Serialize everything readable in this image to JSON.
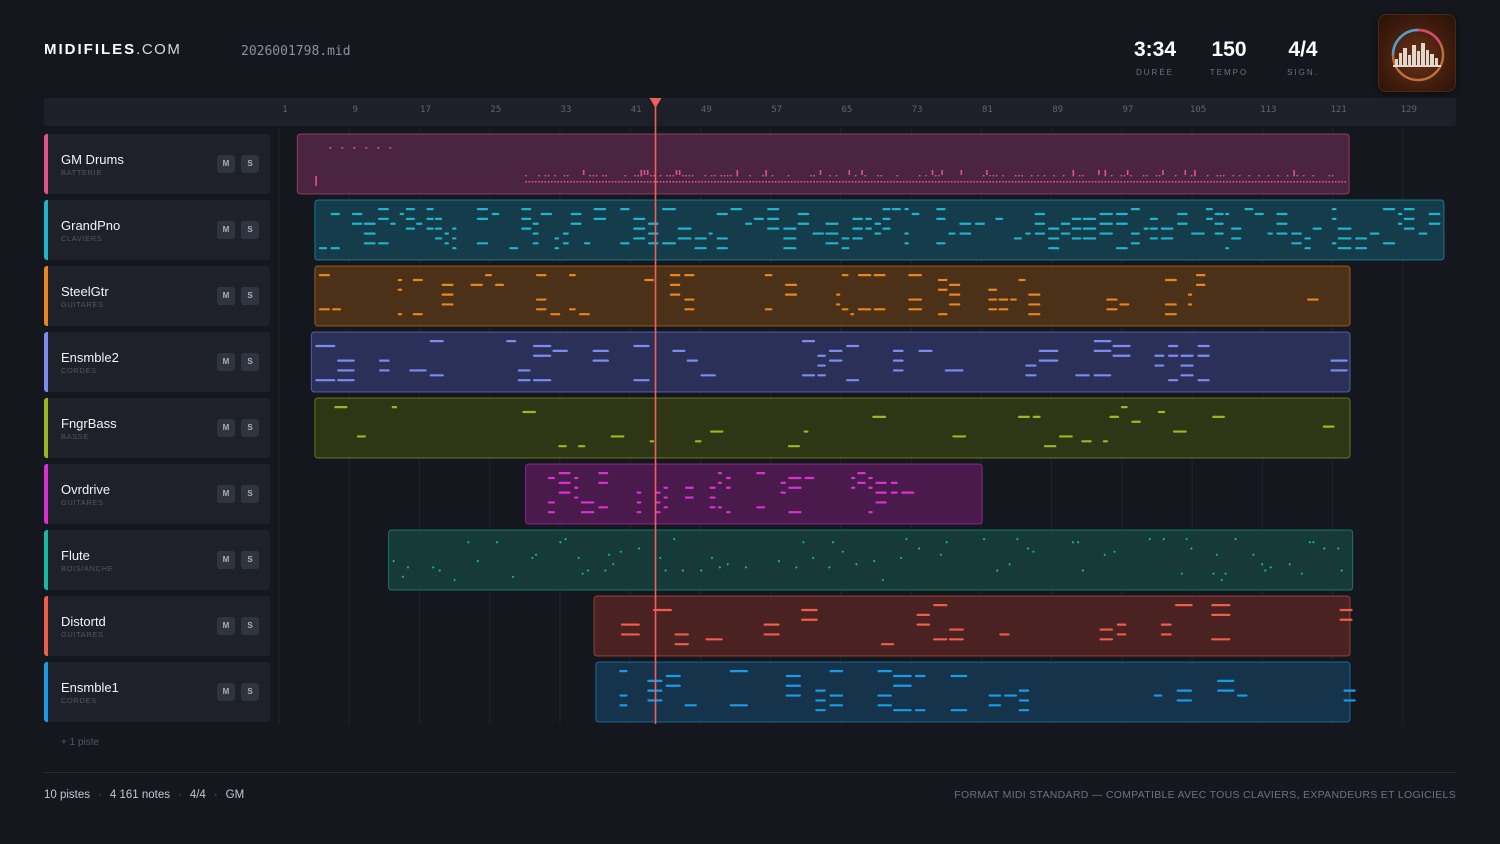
{
  "header": {
    "logo_bold": "MIDIFILES",
    "logo_light": ".COM",
    "filename": "2026001798.mid",
    "stats": [
      {
        "value": "3:34",
        "label": "DURÉE"
      },
      {
        "value": "150",
        "label": "TEMPO"
      },
      {
        "value": "4/4",
        "label": "SIGN."
      }
    ],
    "cover_icon": "album-cover-skyline-icon"
  },
  "ruler": {
    "bars": [
      "1",
      "9",
      "17",
      "25",
      "33",
      "41",
      "49",
      "57",
      "65",
      "73",
      "81",
      "89",
      "97",
      "105",
      "113",
      "121",
      "129"
    ],
    "playhead_bar": 43.2
  },
  "tracks": [
    {
      "name": "GM Drums",
      "category": "BATTERIE",
      "mute": "M",
      "solo": "S",
      "color": "#e0528a",
      "fill": "#4a2440",
      "start_bar": 2.4,
      "end_bar": 122.2,
      "style": "drums"
    },
    {
      "name": "GrandPno",
      "category": "CLAVIERS",
      "mute": "M",
      "solo": "S",
      "color": "#1fb4cc",
      "fill": "#153c4a",
      "start_bar": 4.4,
      "end_bar": 133.0,
      "style": "dense"
    },
    {
      "name": "SteelGtr",
      "category": "GUITARES",
      "mute": "M",
      "solo": "S",
      "color": "#e9851c",
      "fill": "#4a3118",
      "start_bar": 4.4,
      "end_bar": 122.3,
      "style": "chords"
    },
    {
      "name": "Ensmble2",
      "category": "CORDES",
      "mute": "M",
      "solo": "S",
      "color": "#7a8cf0",
      "fill": "#2a3058",
      "start_bar": 4.0,
      "end_bar": 122.3,
      "style": "long"
    },
    {
      "name": "FngrBass",
      "category": "BASSE",
      "mute": "M",
      "solo": "S",
      "color": "#9cb820",
      "fill": "#2f3616",
      "start_bar": 4.4,
      "end_bar": 122.3,
      "style": "bass"
    },
    {
      "name": "Ovrdrive",
      "category": "GUITARES",
      "mute": "M",
      "solo": "S",
      "color": "#d930d2",
      "fill": "#4a1a4c",
      "start_bar": 28.4,
      "end_bar": 80.4,
      "style": "chords"
    },
    {
      "name": "Flute",
      "category": "BOIS/ANCHE",
      "mute": "M",
      "solo": "S",
      "color": "#18b8a0",
      "fill": "#153a38",
      "start_bar": 12.8,
      "end_bar": 122.6,
      "style": "melody"
    },
    {
      "name": "Distortd",
      "category": "GUITARES",
      "mute": "M",
      "solo": "S",
      "color": "#ee5d45",
      "fill": "#4a2222",
      "start_bar": 36.2,
      "end_bar": 122.3,
      "style": "long"
    },
    {
      "name": "Ensmble1",
      "category": "CORDES",
      "mute": "M",
      "solo": "S",
      "color": "#1a9be8",
      "fill": "#15344c",
      "start_bar": 36.4,
      "end_bar": 122.3,
      "style": "long"
    }
  ],
  "more_tracks": "+ 1 piste",
  "footer": {
    "tracks": "10 pistes",
    "notes": "4 161 notes",
    "signature": "4/4",
    "standard": "GM",
    "tagline": "FORMAT MIDI STANDARD — COMPATIBLE AVEC TOUS CLAVIERS, EXPANDEURS ET LOGICIELS"
  }
}
